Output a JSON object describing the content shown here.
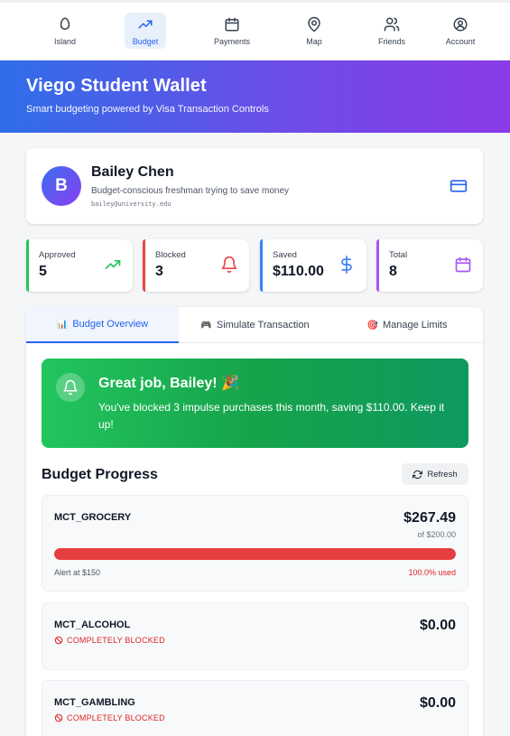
{
  "nav": {
    "items": [
      {
        "label": "Island",
        "icon": "egg-icon"
      },
      {
        "label": "Budget",
        "icon": "trending-up-icon",
        "active": true
      },
      {
        "label": "Payments",
        "icon": "calendar-icon"
      },
      {
        "label": "Map",
        "icon": "map-pin-icon"
      },
      {
        "label": "Friends",
        "icon": "users-icon"
      },
      {
        "label": "Account",
        "icon": "user-circle-icon"
      }
    ]
  },
  "banner": {
    "title": "Viego Student Wallet",
    "subtitle": "Smart budgeting powered by Visa Transaction Controls"
  },
  "profile": {
    "initial": "B",
    "name": "Bailey Chen",
    "bio": "Budget-conscious freshman trying to save money",
    "email": "bailey@university.edu"
  },
  "stats": [
    {
      "label": "Approved",
      "value": "5",
      "color": "#22c55e",
      "icon": "trending-up-icon"
    },
    {
      "label": "Blocked",
      "value": "3",
      "color": "#ef4444",
      "icon": "bell-icon"
    },
    {
      "label": "Saved",
      "value": "$110.00",
      "color": "#3b82f6",
      "icon": "dollar-icon"
    },
    {
      "label": "Total",
      "value": "8",
      "color": "#a855f7",
      "icon": "calendar-icon"
    }
  ],
  "tabs": [
    {
      "label": "Budget Overview",
      "icon": "📊",
      "active": true
    },
    {
      "label": "Simulate Transaction",
      "icon": "🎮"
    },
    {
      "label": "Manage Limits",
      "icon": "🎯"
    }
  ],
  "success": {
    "title": "Great job, Bailey! 🎉",
    "message": "You've blocked 3 impulse purchases this month, saving $110.00. Keep it up!"
  },
  "budget_progress": {
    "title": "Budget Progress",
    "refresh_label": "Refresh",
    "categories": [
      {
        "name": "MCT_GROCERY",
        "amount": "$267.49",
        "limit": "of $200.00",
        "alert": "Alert at $150",
        "used": "100.0% used",
        "progress": 1.0
      },
      {
        "name": "MCT_ALCOHOL",
        "amount": "$0.00",
        "status": "COMPLETELY BLOCKED"
      },
      {
        "name": "MCT_GAMBLING",
        "amount": "$0.00",
        "status": "COMPLETELY BLOCKED"
      }
    ]
  },
  "colors": {
    "accent": "#2563eb",
    "danger": "#e53e3e",
    "success": "#16a34a"
  }
}
